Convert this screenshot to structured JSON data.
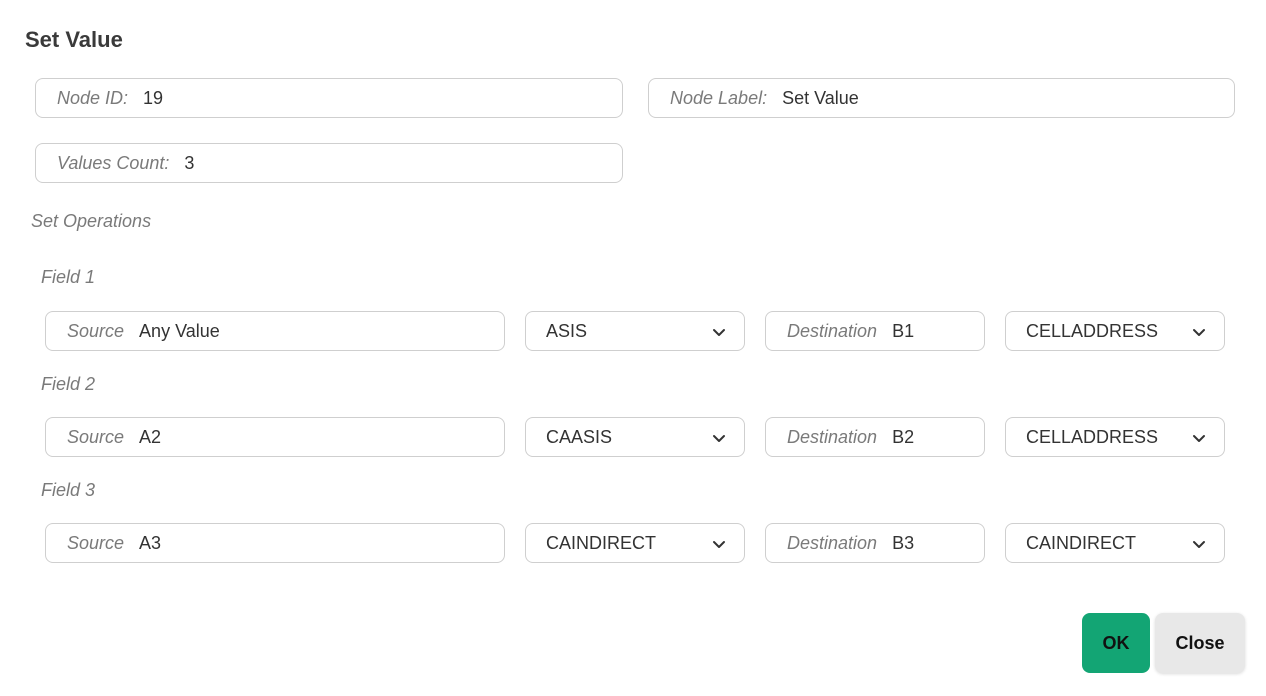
{
  "dialog": {
    "title": "Set Value"
  },
  "node": {
    "id_label": "Node ID:",
    "id_value": "19",
    "label_label": "Node Label:",
    "label_value": "Set Value",
    "count_label": "Values Count:",
    "count_value": "3"
  },
  "operations": {
    "section_label": "Set Operations",
    "fields": [
      {
        "title": "Field 1",
        "source_label": "Source",
        "source_value": "Any Value",
        "source_type": "ASIS",
        "dest_label": "Destination",
        "dest_value": "B1",
        "dest_type": "CELLADDRESS"
      },
      {
        "title": "Field 2",
        "source_label": "Source",
        "source_value": "A2",
        "source_type": "CAASIS",
        "dest_label": "Destination",
        "dest_value": "B2",
        "dest_type": "CELLADDRESS"
      },
      {
        "title": "Field 3",
        "source_label": "Source",
        "source_value": "A3",
        "source_type": "CAINDIRECT",
        "dest_label": "Destination",
        "dest_value": "B3",
        "dest_type": "CAINDIRECT"
      }
    ]
  },
  "buttons": {
    "ok_label": "OK",
    "close_label": "Close"
  },
  "icons": {
    "dropdown": "chevron-down-icon"
  },
  "colors": {
    "ok_button": "#13a574",
    "close_button": "#e8e8e8"
  }
}
